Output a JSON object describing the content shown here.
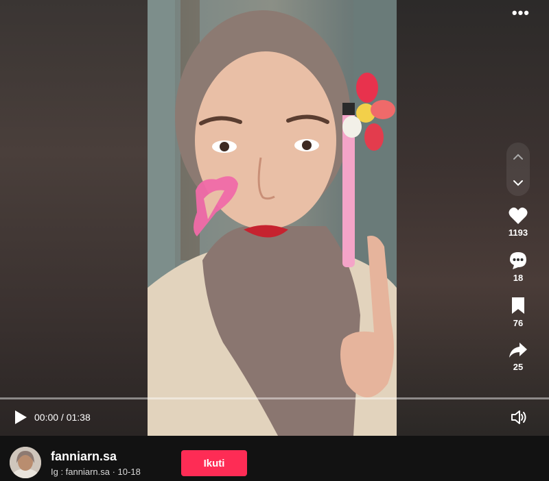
{
  "video": {
    "current_time": "00:00",
    "separator": " / ",
    "duration": "01:38",
    "progress": 0
  },
  "actions": {
    "likes": "1193",
    "comments": "18",
    "saves": "76",
    "shares": "25"
  },
  "author": {
    "username": "fanniarn.sa",
    "subtitle": "Ig : fanniarn.sa · 10-18",
    "follow_label": "Ikuti"
  },
  "colors": {
    "follow_button": "#fe2c55",
    "background": "#121212"
  },
  "icons": [
    "more-icon",
    "chevron-up-icon",
    "chevron-down-icon",
    "heart-icon",
    "comment-icon",
    "bookmark-icon",
    "share-icon",
    "play-icon",
    "volume-icon"
  ]
}
